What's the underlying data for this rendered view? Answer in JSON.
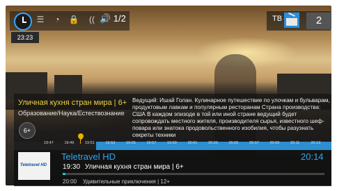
{
  "top_bar": {
    "clock_time": "23:23",
    "audio_track": "1/2",
    "tv_label": "ТВ",
    "channel_number": "2",
    "icons": [
      "clock-icon",
      "menu-icon",
      "dish-icon",
      "lock-icon",
      "signal-icon",
      "speaker-icon",
      "tv-icon"
    ]
  },
  "program": {
    "title": "Уличная кухня стран мира | 6+",
    "genre": "Образование/Наука/Естествознание",
    "age_rating": "6+",
    "description": "Ведущий: Ишай Голан. Кулинарное путешествие по улочкам и бульварам, продуктовым лавкам и популярным ресторанам Страна производства: США В каждом эпизоде в той или иной стране ведущий будет сопровождать местного жителя, производителя сырья, известного шеф-повара или знатока продовольственного изобилия, чтобы разузнать секреты техники"
  },
  "timeline": {
    "ticks": [
      "19:47",
      "19:49",
      "19:51",
      "19:53",
      "19:55",
      "19:57",
      "19:59",
      "20:01",
      "20:03",
      "20:05",
      "20:07",
      "20:09",
      "20:11",
      "20:13"
    ]
  },
  "channel": {
    "name": "Teletravel HD",
    "logo_text": "Teletravel HD",
    "current_time": "20:14",
    "now_time": "19:30",
    "now_title": "Уличная кухня стран мира | 6+",
    "now_progress": 0.01,
    "next_time": "20:00",
    "next_title": "Удивительные приключения | 12+"
  },
  "colors": {
    "accent_blue": "#2fa8f0",
    "title_yellow": "#f0d23a",
    "timeline_blue": "#2d8ed0"
  }
}
